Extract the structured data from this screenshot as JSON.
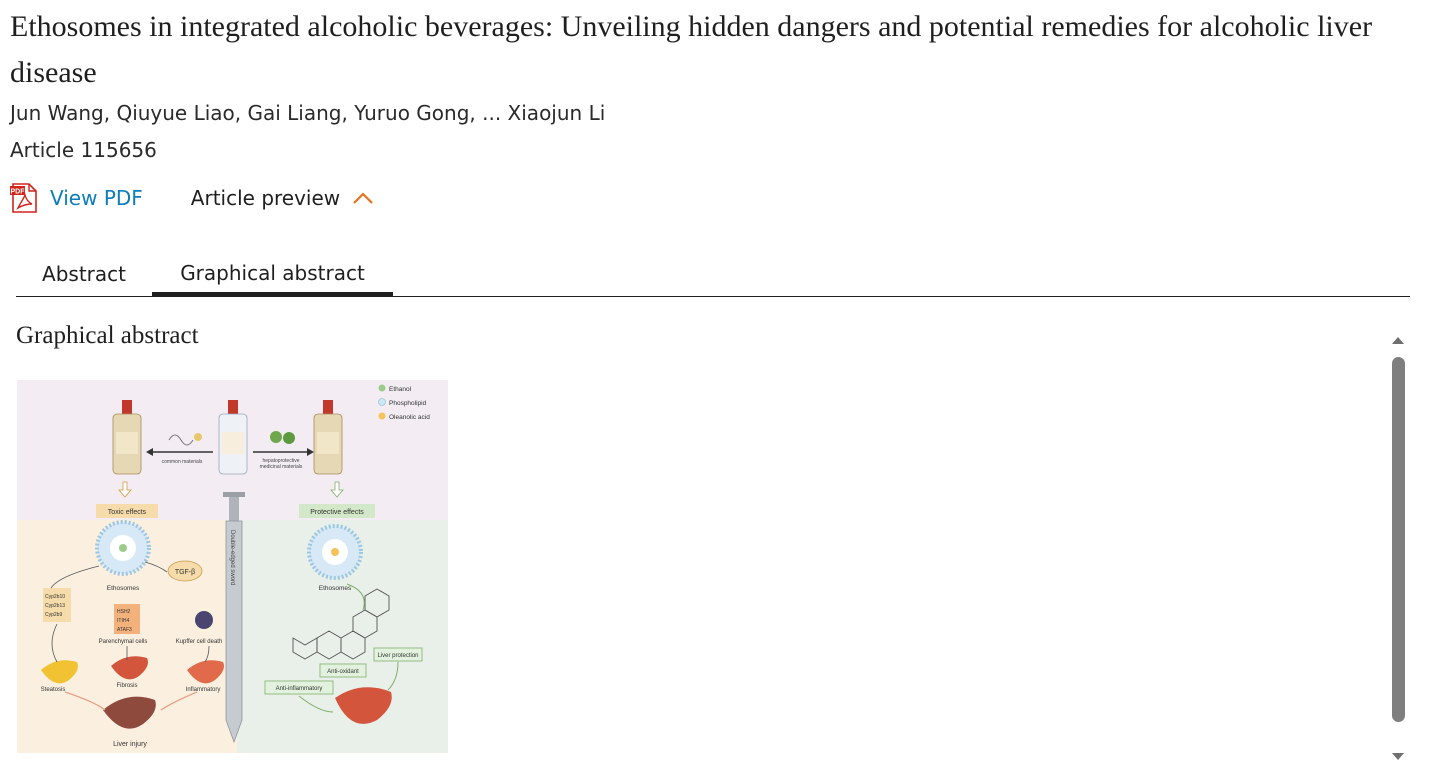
{
  "article": {
    "title": "Ethosomes in integrated alcoholic beverages: Unveiling hidden dangers and potential remedies for alcoholic liver disease",
    "authors": "Jun Wang, Qiuyue Liao, Gai Liang, Yuruo Gong, ... Xiaojun Li",
    "article_number": "Article 115656"
  },
  "actions": {
    "pdf_badge": "PDF",
    "view_pdf_label": "View PDF",
    "preview_label": "Article preview"
  },
  "tabs": [
    {
      "label": "Abstract",
      "active": false
    },
    {
      "label": "Graphical abstract",
      "active": true
    }
  ],
  "section": {
    "heading": "Graphical abstract"
  },
  "figure": {
    "legend": [
      "Ethanol",
      "Phospholipid",
      "Oleanolic acid"
    ],
    "arrow_left_label": "common materials",
    "arrow_right_label_1": "hepatoprotective",
    "arrow_right_label_2": "medicinal materials",
    "toxic": "Toxic effects",
    "protective": "Protective effects",
    "sword": "Double-edged sword",
    "ethosomes_left": "Ethosomes",
    "ethosomes_right": "Ethosomes",
    "tgf": "TGF-β",
    "cyps": [
      "Cyp2b10",
      "Cyp2b13",
      "Cyp2b9"
    ],
    "genes": [
      "HSH2",
      "ITIH4",
      "ATAF3"
    ],
    "parenchymal": "Parenchymal cells",
    "kupffer": "Kupffer cell death",
    "steatosis": "Steatosis",
    "fibrosis": "Fibrosis",
    "inflammatory": "Inflammatory",
    "liver_injury": "Liver injury",
    "liver_protection": "Liver protection",
    "anti_oxidant": "Anti-oxidant",
    "anti_inflammatory": "Anti-inflammatory"
  },
  "colors": {
    "link": "#0c7dbb",
    "accent_chevron": "#e9711c",
    "pdf_red": "#d0251b",
    "scrollbar": "#7f7f7f"
  }
}
